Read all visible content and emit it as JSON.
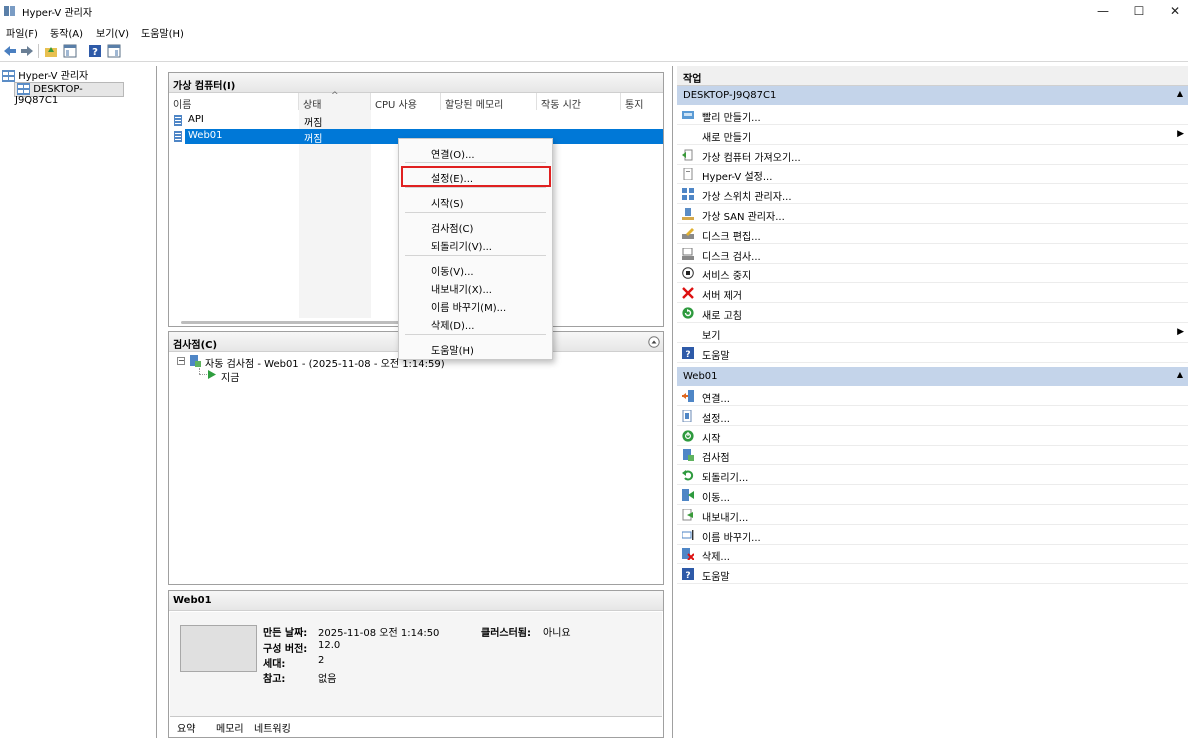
{
  "window": {
    "title": "Hyper-V 관리자",
    "minimize": "—",
    "maximize": "☐",
    "close": "✕"
  },
  "menu": [
    "파일(F)",
    "동작(A)",
    "보기(V)",
    "도움말(H)"
  ],
  "tree": {
    "root": "Hyper-V 관리자",
    "server": "DESKTOP-J9Q87C1"
  },
  "vm_panel": {
    "title": "가상 컴퓨터(I)",
    "columns": [
      "이름",
      "상태",
      "CPU 사용",
      "할당된 메모리",
      "작동 시간",
      "통지"
    ],
    "rows": [
      {
        "name": "API",
        "state": "꺼짐"
      },
      {
        "name": "Web01",
        "state": "꺼짐"
      }
    ]
  },
  "context_menu": {
    "items": [
      "연결(O)...",
      "설정(E)...",
      "시작(S)",
      "검사점(C)",
      "되돌리기(V)...",
      "이동(V)...",
      "내보내기(X)...",
      "이름 바꾸기(M)...",
      "삭제(D)...",
      "도움말(H)"
    ]
  },
  "checkpoint_panel": {
    "title": "검사점(C)",
    "item": "자동 검사점 - Web01 - (2025-11-08 - 오전 1:14:59)",
    "now": "지금"
  },
  "details_panel": {
    "title": "Web01",
    "created_label": "만든 날짜:",
    "created_value": "2025-11-08 오전 1:14:50",
    "cluster_label": "클러스터됨:",
    "cluster_value": "아니요",
    "version_label": "구성 버전:",
    "version_value": "12.0",
    "gen_label": "세대:",
    "gen_value": "2",
    "note_label": "참고:",
    "note_value": "없음",
    "tabs": [
      "요약",
      "메모리",
      "네트워킹"
    ]
  },
  "actions": {
    "title": "작업",
    "server_section": "DESKTOP-J9Q87C1",
    "server_items": [
      {
        "label": "빨리 만들기...",
        "icon": "quick-create-icon"
      },
      {
        "label": "새로 만들기",
        "icon": "none",
        "submenu": true
      },
      {
        "label": "가상 컴퓨터 가져오기...",
        "icon": "import-icon"
      },
      {
        "label": "Hyper-V 설정...",
        "icon": "settings-doc-icon"
      },
      {
        "label": "가상 스위치 관리자...",
        "icon": "switch-icon"
      },
      {
        "label": "가상 SAN 관리자...",
        "icon": "san-icon"
      },
      {
        "label": "디스크 편집...",
        "icon": "disk-edit-icon"
      },
      {
        "label": "디스크 검사...",
        "icon": "disk-inspect-icon"
      },
      {
        "label": "서비스 중지",
        "icon": "stop-icon"
      },
      {
        "label": "서버 제거",
        "icon": "remove-icon"
      },
      {
        "label": "새로 고침",
        "icon": "refresh-icon"
      },
      {
        "label": "보기",
        "icon": "none",
        "submenu": true
      },
      {
        "label": "도움말",
        "icon": "help-icon"
      }
    ],
    "vm_section": "Web01",
    "vm_items": [
      {
        "label": "연결...",
        "icon": "connect-icon"
      },
      {
        "label": "설정...",
        "icon": "settings-icon"
      },
      {
        "label": "시작",
        "icon": "start-icon"
      },
      {
        "label": "검사점",
        "icon": "checkpoint-icon"
      },
      {
        "label": "되돌리기...",
        "icon": "revert-icon"
      },
      {
        "label": "이동...",
        "icon": "move-icon"
      },
      {
        "label": "내보내기...",
        "icon": "export-icon"
      },
      {
        "label": "이름 바꾸기...",
        "icon": "rename-icon"
      },
      {
        "label": "삭제...",
        "icon": "delete-icon"
      },
      {
        "label": "도움말",
        "icon": "help-icon"
      }
    ]
  }
}
